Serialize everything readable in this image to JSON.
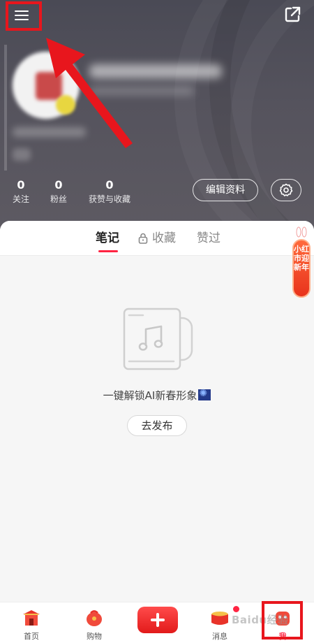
{
  "header": {
    "stats": [
      {
        "value": "0",
        "label": "关注"
      },
      {
        "value": "0",
        "label": "粉丝"
      },
      {
        "value": "0",
        "label": "获赞与收藏"
      }
    ],
    "edit_profile_label": "编辑资料"
  },
  "tabs": {
    "notes": "笔记",
    "collect": "收藏",
    "liked": "赞过"
  },
  "empty_state": {
    "message": "一键解锁AI新春形象",
    "publish_label": "去发布"
  },
  "promo": {
    "label": "小红市迎新年"
  },
  "bottom_nav": {
    "home": "首页",
    "shop": "购物",
    "messages": "消息",
    "me": "我"
  },
  "watermark": "Baidu经验",
  "colors": {
    "accent": "#ff2442",
    "annotation": "#e8161d",
    "header_bg": "#4a4a55"
  },
  "icons": [
    "menu-icon",
    "share-icon",
    "settings-icon",
    "lock-icon",
    "music-note-icon",
    "home-icon",
    "shopping-icon",
    "plus-icon",
    "message-icon",
    "me-icon"
  ]
}
